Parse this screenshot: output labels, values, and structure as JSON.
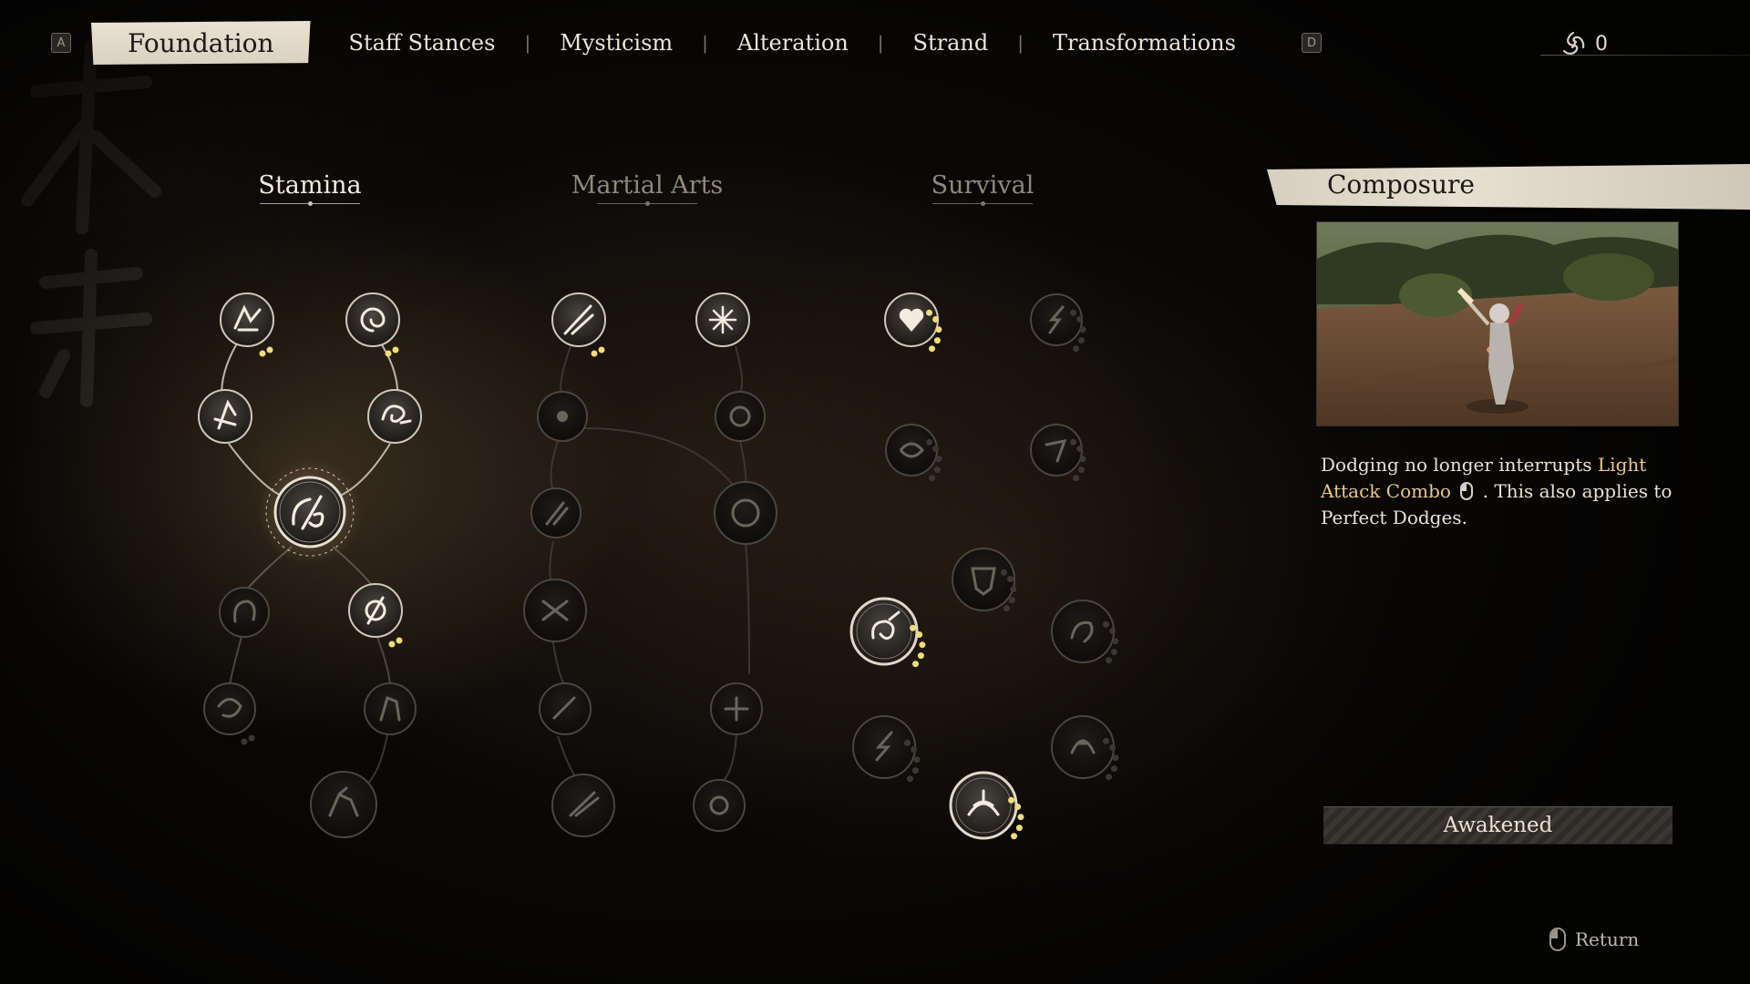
{
  "nav": {
    "key_left": "A",
    "key_right": "D",
    "tabs": [
      "Foundation",
      "Staff Stances",
      "Mysticism",
      "Alteration",
      "Strand",
      "Transformations"
    ],
    "active_tab": "Foundation",
    "currency_value": "0"
  },
  "columns": {
    "stamina": "Stamina",
    "martial_arts": "Martial Arts",
    "survival": "Survival"
  },
  "detail": {
    "title": "Composure",
    "desc_part1": "Dodging no longer interrupts ",
    "desc_highlight": "Light Attack Combo",
    "desc_part2": " . This also applies to Perfect Dodges.",
    "status_button": "Awakened",
    "return_label": "Return"
  },
  "skill_tree": {
    "colors": {
      "dot_active": "#f0dc7a",
      "dot_inactive": "#3b3833"
    },
    "stamina_nodes": [
      {
        "id": "st1",
        "state": "unlocked",
        "dots_filled": 2,
        "dots_total": 2
      },
      {
        "id": "st2",
        "state": "unlocked",
        "dots_filled": 2,
        "dots_total": 2
      },
      {
        "id": "st3",
        "state": "unlocked",
        "dots_filled": 0,
        "dots_total": 0
      },
      {
        "id": "st4",
        "state": "unlocked",
        "dots_filled": 0,
        "dots_total": 0
      },
      {
        "id": "st5",
        "state": "selected",
        "dots_filled": 0,
        "dots_total": 0
      },
      {
        "id": "st6",
        "state": "locked",
        "dots_filled": 0,
        "dots_total": 0
      },
      {
        "id": "st7",
        "state": "unlocked",
        "dots_filled": 2,
        "dots_total": 2
      },
      {
        "id": "st8",
        "state": "locked",
        "dots_filled": 0,
        "dots_total": 2
      },
      {
        "id": "st9",
        "state": "locked",
        "dots_filled": 0,
        "dots_total": 0
      },
      {
        "id": "st10",
        "state": "locked",
        "dots_filled": 0,
        "dots_total": 0
      }
    ],
    "martial_nodes": [
      {
        "id": "ma1",
        "state": "unlocked",
        "dots_filled": 2,
        "dots_total": 2
      },
      {
        "id": "ma2",
        "state": "unlocked",
        "dots_filled": 0,
        "dots_total": 0
      },
      {
        "id": "ma3",
        "state": "locked",
        "dots_filled": 0,
        "dots_total": 0
      },
      {
        "id": "ma4",
        "state": "locked",
        "dots_filled": 0,
        "dots_total": 0
      },
      {
        "id": "ma5",
        "state": "locked",
        "dots_filled": 0,
        "dots_total": 0
      },
      {
        "id": "ma6",
        "state": "locked",
        "dots_filled": 0,
        "dots_total": 0
      },
      {
        "id": "ma7",
        "state": "locked",
        "dots_filled": 0,
        "dots_total": 0
      },
      {
        "id": "ma8",
        "state": "locked",
        "dots_filled": 0,
        "dots_total": 0
      },
      {
        "id": "ma9",
        "state": "locked",
        "dots_filled": 0,
        "dots_total": 0
      },
      {
        "id": "ma10",
        "state": "locked",
        "dots_filled": 0,
        "dots_total": 0
      },
      {
        "id": "ma11",
        "state": "locked",
        "dots_filled": 0,
        "dots_total": 0
      },
      {
        "id": "ma12",
        "state": "locked",
        "dots_filled": 0,
        "dots_total": 0
      }
    ],
    "survival_nodes": [
      {
        "id": "sv1",
        "state": "unlocked",
        "dots_filled": 5,
        "dots_total": 5
      },
      {
        "id": "sv2",
        "state": "locked",
        "dots_filled": 0,
        "dots_total": 5
      },
      {
        "id": "sv3",
        "state": "locked",
        "dots_filled": 0,
        "dots_total": 5
      },
      {
        "id": "sv4",
        "state": "locked",
        "dots_filled": 0,
        "dots_total": 5
      },
      {
        "id": "sv5",
        "state": "locked",
        "dots_filled": 0,
        "dots_total": 5
      },
      {
        "id": "sv6",
        "state": "unlocked",
        "dots_filled": 5,
        "dots_total": 5
      },
      {
        "id": "sv7",
        "state": "locked",
        "dots_filled": 0,
        "dots_total": 5
      },
      {
        "id": "sv8",
        "state": "locked",
        "dots_filled": 0,
        "dots_total": 5
      },
      {
        "id": "sv9",
        "state": "locked",
        "dots_filled": 0,
        "dots_total": 5
      },
      {
        "id": "sv10",
        "state": "unlocked",
        "dots_filled": 5,
        "dots_total": 5
      }
    ]
  }
}
